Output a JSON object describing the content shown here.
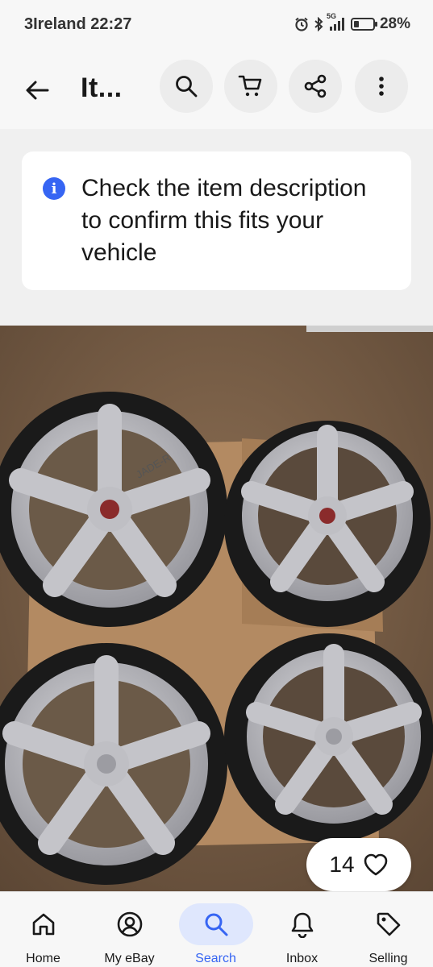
{
  "status": {
    "carrier_time": "3Ireland 22:27",
    "network": "5G",
    "battery": "28%"
  },
  "header": {
    "title": "It...",
    "icons": [
      "back-arrow-icon",
      "search-icon",
      "cart-icon",
      "share-icon",
      "more-vertical-icon"
    ]
  },
  "notice": {
    "icon": "info-icon",
    "text": "Check the item description to confirm this fits your vehicle"
  },
  "photo": {
    "wheel_brand": "JADE-R",
    "description": "four alloy wheels with tyres"
  },
  "favorite": {
    "count": "14",
    "icon": "heart-outline-icon"
  },
  "nav": {
    "items": [
      {
        "label": "Home",
        "icon": "home-icon"
      },
      {
        "label": "My eBay",
        "icon": "user-icon"
      },
      {
        "label": "Search",
        "icon": "search-icon"
      },
      {
        "label": "Inbox",
        "icon": "bell-icon"
      },
      {
        "label": "Selling",
        "icon": "tag-icon"
      }
    ],
    "active": "Search"
  },
  "colors": {
    "accent": "#3665f3",
    "active_bg": "#dfe7fd",
    "background": "#f7f7f7"
  }
}
